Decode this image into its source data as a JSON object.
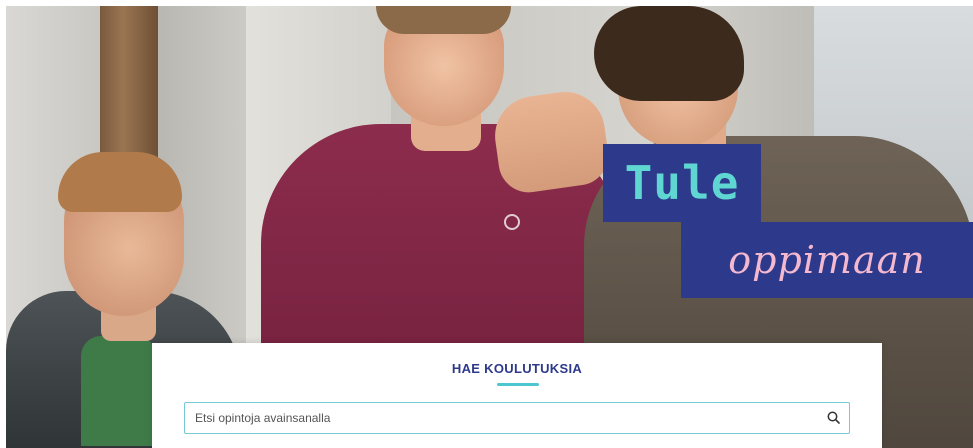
{
  "hero": {
    "headline_line1": "Tule",
    "headline_line2": "oppimaan",
    "shirt_print": "",
    "colors": {
      "badge_bg": "#2d3a8c",
      "headline_line1": "#5fd6d2",
      "headline_line2": "#f4b9cf"
    }
  },
  "search": {
    "title": "HAE KOULUTUKSIA",
    "placeholder": "Etsi opintoja avainsanalla",
    "value": "",
    "button_icon": "search-icon",
    "colors": {
      "title": "#2d3a8c",
      "accent": "#4cc7cf",
      "border": "#77c9d4"
    }
  }
}
